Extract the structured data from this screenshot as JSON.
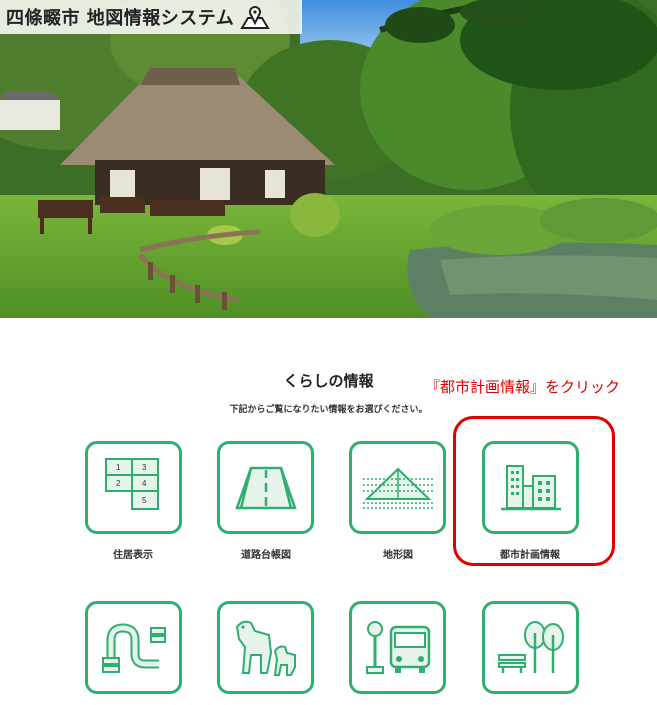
{
  "header": {
    "title": "四條畷市 地図情報システム",
    "title_icon": "map-pin-icon"
  },
  "section": {
    "heading": "くらしの情報",
    "subheading": "下記からご覧になりたい情報をお選びください。"
  },
  "annotation": {
    "text": "『都市計画情報』をクリック",
    "color": "#e00000"
  },
  "colors": {
    "accent": "#2eae6f",
    "highlight": "#e00000"
  },
  "menu": {
    "row1": [
      {
        "label": "住居表示",
        "icon": "address-grid-icon",
        "cells": [
          "1",
          "3",
          "2",
          "4",
          "5"
        ]
      },
      {
        "label": "道路台帳図",
        "icon": "road-icon"
      },
      {
        "label": "地形図",
        "icon": "terrain-icon"
      },
      {
        "label": "都市計画情報",
        "icon": "city-buildings-icon"
      }
    ],
    "row2": [
      {
        "icon": "sewer-pipe-icon"
      },
      {
        "icon": "cultural-property-horse-icon"
      },
      {
        "icon": "bus-stop-icon"
      },
      {
        "icon": "park-trees-icon"
      }
    ]
  }
}
